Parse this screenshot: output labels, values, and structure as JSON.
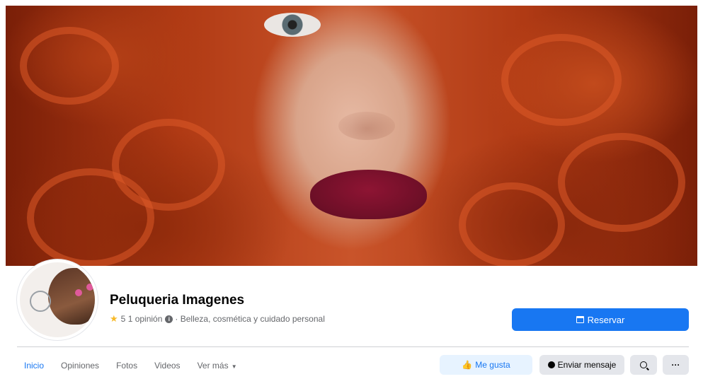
{
  "header": {
    "page_name": "Peluqueria Imagenes",
    "rating": "5",
    "reviews": "1 opinión",
    "separator": "·",
    "category": "Belleza, cosmética y cuidado personal",
    "book_button": "Reservar"
  },
  "tabs": [
    {
      "label": "Inicio",
      "active": true
    },
    {
      "label": "Opiniones"
    },
    {
      "label": "Fotos"
    },
    {
      "label": "Videos"
    },
    {
      "label": "Ver más"
    }
  ],
  "actions": {
    "like": "Me gusta",
    "message": "Enviar mensaje",
    "more": "···"
  },
  "icons": {
    "star": "star-icon",
    "info": "info-icon",
    "calendar": "calendar-icon",
    "like": "thumbs-up-icon",
    "messenger": "messenger-icon",
    "search": "search-icon",
    "more": "more-icon"
  },
  "colors": {
    "accent": "#1877f2",
    "like_bg": "#e7f3ff",
    "secondary_bg": "#e4e6eb",
    "star": "#f7b928"
  }
}
